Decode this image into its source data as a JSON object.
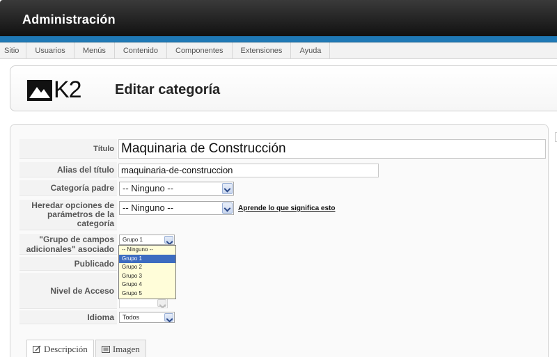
{
  "header": {
    "title": "Administración"
  },
  "menu": {
    "items": [
      "Sitio",
      "Usuarios",
      "Menús",
      "Contenido",
      "Componentes",
      "Extensiones",
      "Ayuda"
    ]
  },
  "page": {
    "logo_text": "K2",
    "title": "Editar categoría"
  },
  "form": {
    "titulo": {
      "label": "Título",
      "value": "Maquinaria de Construcción"
    },
    "alias": {
      "label": "Alias del título",
      "value": "maquinaria-de-construccion"
    },
    "categoria_padre": {
      "label": "Categoría padre",
      "selected": "-- Ninguno --"
    },
    "heredar": {
      "label_line1": "Heredar opciones de",
      "label_line2": "parámetros de la",
      "label_line3": "categoría",
      "selected": "-- Ninguno --",
      "link": "Aprende lo que significa esto"
    },
    "grupo": {
      "label_line1": "\"Grupo de campos",
      "label_line2": "adicionales\" asociado",
      "selected": "Grupo 1",
      "options": [
        "-- Ninguno --",
        "Grupo 1",
        "Grupo 2",
        "Grupo 3",
        "Grupo 4",
        "Grupo 5"
      ],
      "highlighted_index": 1
    },
    "publicado": {
      "label": "Publicado"
    },
    "nivel_acceso": {
      "label": "Nivel de Acceso"
    },
    "idioma": {
      "label": "Idioma",
      "selected": "Todos"
    }
  },
  "tabs": [
    "Descripción",
    "Imagen"
  ],
  "colors": {
    "accent_blue": "#1f79b6",
    "dropdown_bg": "#fffdd9",
    "selection": "#3d6cc0"
  }
}
